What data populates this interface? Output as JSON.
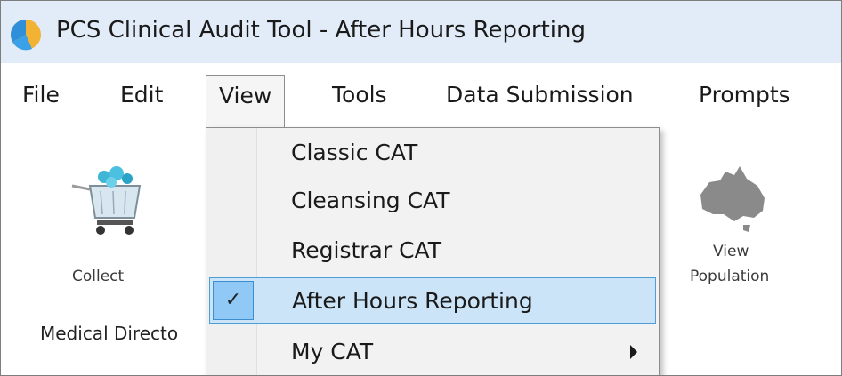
{
  "window": {
    "title": "PCS Clinical Audit Tool - After Hours Reporting",
    "icon": "pcs-app-icon"
  },
  "menubar": {
    "items": [
      "File",
      "Edit",
      "View",
      "Tools",
      "Data Submission",
      "Prompts"
    ],
    "open_menu": "View"
  },
  "toolbar": {
    "collect_label": "Collect",
    "group_label": "Medical Directo",
    "view_population_label_line1": "View",
    "view_population_label_line2": "Population",
    "icons": [
      "shopping-cart-icon",
      "australia-map-icon"
    ]
  },
  "view_menu": {
    "items": [
      {
        "label": "Classic CAT",
        "checked": false,
        "submenu": false
      },
      {
        "label": "Cleansing CAT",
        "checked": false,
        "submenu": false
      },
      {
        "label": "Registrar CAT",
        "checked": false,
        "submenu": false
      },
      {
        "label": "After Hours Reporting",
        "checked": true,
        "submenu": false
      },
      {
        "label": "My CAT",
        "checked": false,
        "submenu": true
      }
    ],
    "check_glyph": "✓"
  },
  "colors": {
    "titlebar": "#e2ecf8",
    "highlight": "#cce4f7",
    "highlight_border": "#4e9ed6"
  }
}
